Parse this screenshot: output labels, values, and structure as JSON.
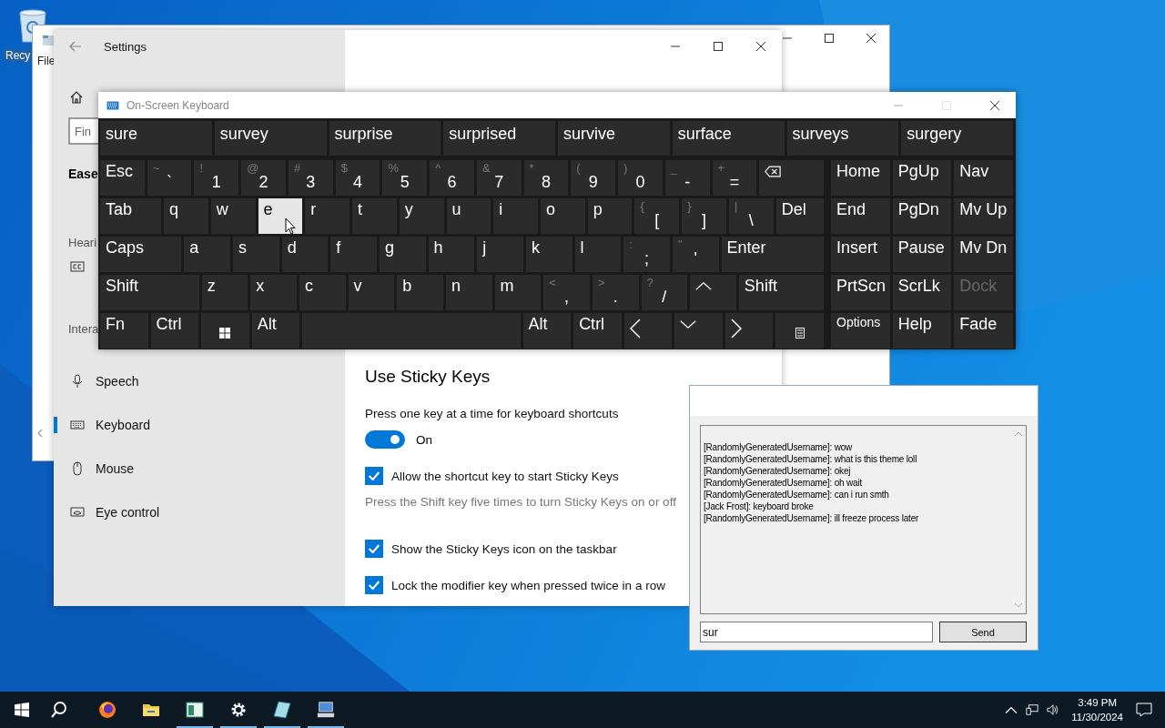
{
  "desktop": {
    "icons": [
      {
        "label": "Recy",
        "selected": true
      }
    ]
  },
  "explorer_window": {
    "label": "File"
  },
  "settings_window": {
    "title": "Settings",
    "search": {
      "placeholder": "Fin"
    },
    "sidebar": {
      "category": "Ease",
      "hearing_label": "Heari",
      "interaction_label": "Intera",
      "items": [
        {
          "label": "Speech",
          "selected": false
        },
        {
          "label": "Keyboard",
          "selected": true
        },
        {
          "label": "Mouse",
          "selected": false
        },
        {
          "label": "Eye control",
          "selected": false
        }
      ]
    },
    "content": {
      "heading": "Use Sticky Keys",
      "toggle": {
        "label": "Press one key at a time for keyboard shortcuts",
        "on": true,
        "state_text": "On"
      },
      "options": [
        {
          "label": "Allow the shortcut key to start Sticky Keys",
          "checked": true,
          "hint": "Press the Shift key five times to turn Sticky Keys on or off"
        },
        {
          "label": "Show the Sticky Keys icon on the taskbar",
          "checked": true
        },
        {
          "label": "Lock the modifier key when pressed twice in a row",
          "checked": true
        }
      ]
    }
  },
  "osk": {
    "title": "On-Screen Keyboard",
    "suggestions": [
      "sure",
      "survey",
      "surprise",
      "surprised",
      "survive",
      "surface",
      "surveys",
      "surgery"
    ],
    "rows": [
      [
        {
          "label": "Esc",
          "hover": false
        },
        {
          "label": "`",
          "shift": "~",
          "hover": false
        },
        {
          "label": "1",
          "shift": "!",
          "hover": false
        },
        {
          "label": "2",
          "shift": "@",
          "hover": false
        },
        {
          "label": "3",
          "shift": "#",
          "hover": false
        },
        {
          "label": "4",
          "shift": "$",
          "hover": false
        },
        {
          "label": "5",
          "shift": "%",
          "hover": false
        },
        {
          "label": "6",
          "shift": "^",
          "hover": false
        },
        {
          "label": "7",
          "shift": "&",
          "hover": false
        },
        {
          "label": "8",
          "shift": "*",
          "hover": false
        },
        {
          "label": "9",
          "shift": "(",
          "hover": false
        },
        {
          "label": "0",
          "shift": ")",
          "hover": false
        },
        {
          "label": "-",
          "shift": "_",
          "hover": false
        },
        {
          "label": "=",
          "shift": "+",
          "hover": false
        },
        {
          "kind": "backspace",
          "hover": false
        }
      ],
      [
        {
          "label": "Tab",
          "hover": false
        },
        {
          "label": "q",
          "hover": false
        },
        {
          "label": "w",
          "hover": false
        },
        {
          "label": "e",
          "hover": true
        },
        {
          "label": "r",
          "hover": false
        },
        {
          "label": "t",
          "hover": false
        },
        {
          "label": "y",
          "hover": false
        },
        {
          "label": "u",
          "hover": false
        },
        {
          "label": "i",
          "hover": false
        },
        {
          "label": "o",
          "hover": false
        },
        {
          "label": "p",
          "hover": false
        },
        {
          "label": "[",
          "shift": "{",
          "hover": false
        },
        {
          "label": "]",
          "shift": "}",
          "hover": false
        },
        {
          "label": "\\",
          "shift": "|",
          "hover": false
        },
        {
          "label": "Del",
          "hover": false
        }
      ],
      [
        {
          "label": "Caps",
          "hover": false
        },
        {
          "label": "a",
          "hover": false
        },
        {
          "label": "s",
          "hover": false
        },
        {
          "label": "d",
          "hover": false
        },
        {
          "label": "f",
          "hover": false
        },
        {
          "label": "g",
          "hover": false
        },
        {
          "label": "h",
          "hover": false
        },
        {
          "label": "j",
          "hover": false
        },
        {
          "label": "k",
          "hover": false
        },
        {
          "label": "l",
          "hover": false
        },
        {
          "label": ";",
          "shift": ":",
          "hover": false
        },
        {
          "label": "'",
          "shift": "\"",
          "hover": false
        },
        {
          "label": "Enter",
          "hover": false
        }
      ],
      [
        {
          "label": "Shift",
          "hover": false
        },
        {
          "label": "z",
          "hover": false
        },
        {
          "label": "x",
          "hover": false
        },
        {
          "label": "c",
          "hover": false
        },
        {
          "label": "v",
          "hover": false
        },
        {
          "label": "b",
          "hover": false
        },
        {
          "label": "n",
          "hover": false
        },
        {
          "label": "m",
          "hover": false
        },
        {
          "label": ",",
          "shift": "<",
          "hover": false
        },
        {
          "label": ".",
          "shift": ">",
          "hover": false
        },
        {
          "label": "/",
          "shift": "?",
          "hover": false
        },
        {
          "kind": "up",
          "hover": false
        },
        {
          "label": "Shift",
          "hover": false
        }
      ],
      [
        {
          "label": "Fn",
          "hover": false
        },
        {
          "label": "Ctrl",
          "hover": false
        },
        {
          "kind": "windows",
          "hover": false
        },
        {
          "label": "Alt",
          "hover": false
        },
        {
          "kind": "space",
          "hover": false
        },
        {
          "label": "Alt",
          "hover": false
        },
        {
          "label": "Ctrl",
          "hover": false
        },
        {
          "kind": "left",
          "hover": false
        },
        {
          "kind": "down",
          "hover": false
        },
        {
          "kind": "right",
          "hover": false
        },
        {
          "kind": "menu",
          "hover": false
        }
      ]
    ],
    "side_keys": [
      {
        "label": "Home",
        "disabled": false
      },
      {
        "label": "PgUp",
        "disabled": false
      },
      {
        "label": "Nav",
        "disabled": false
      },
      {
        "label": "End",
        "disabled": false
      },
      {
        "label": "PgDn",
        "disabled": false
      },
      {
        "label": "Mv Up",
        "disabled": false
      },
      {
        "label": "Insert",
        "disabled": false
      },
      {
        "label": "Pause",
        "disabled": false
      },
      {
        "label": "Mv Dn",
        "disabled": false
      },
      {
        "label": "PrtScn",
        "disabled": false
      },
      {
        "label": "ScrLk",
        "disabled": false
      },
      {
        "label": "Dock",
        "disabled": true
      },
      {
        "label": "Options",
        "disabled": false
      },
      {
        "label": "Help",
        "disabled": false
      },
      {
        "label": "Fade",
        "disabled": false
      }
    ]
  },
  "chat_window": {
    "messages": [
      "[RandomlyGeneratedUsername]: wow",
      "[RandomlyGeneratedUsername]: what is this theme loll",
      "[RandomlyGeneratedUsername]: okej",
      "[RandomlyGeneratedUsername]: oh wait",
      "[RandomlyGeneratedUsername]: can i run smth",
      "[Jack Frost]: keyboard broke",
      "[RandomlyGeneratedUsername]: ill freeze process later"
    ],
    "input": {
      "value": "sur"
    },
    "send_button": "Send"
  },
  "taskbar": {
    "apps": [
      {
        "running": false
      },
      {
        "running": false
      },
      {
        "running": true
      },
      {
        "running": true
      },
      {
        "running": true
      },
      {
        "running": true
      }
    ],
    "clock": {
      "time": "3:49 PM",
      "date": "11/30/2024"
    }
  }
}
